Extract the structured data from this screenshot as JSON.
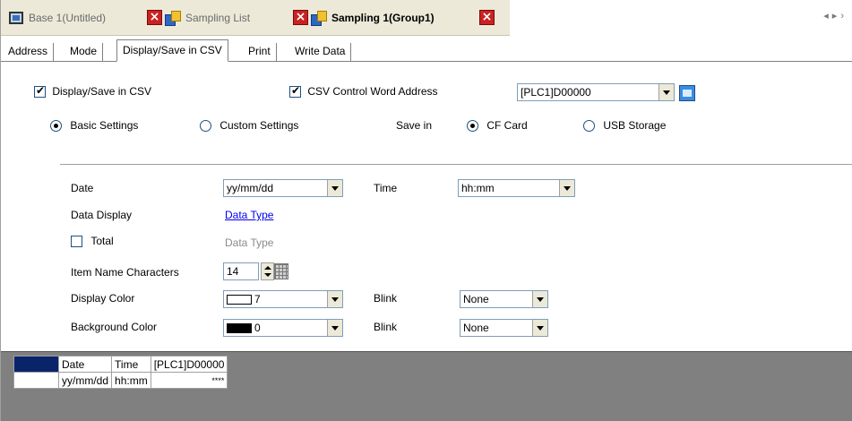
{
  "doc_tabs": [
    {
      "label": "Base 1(Untitled)",
      "icon": "monitor-icon",
      "active": false
    },
    {
      "label": "Sampling List",
      "icon": "list-icon",
      "active": false
    },
    {
      "label": "Sampling 1(Group1)",
      "icon": "list-icon",
      "active": true
    }
  ],
  "prop_tabs": [
    "Address",
    "Mode",
    "Display/Save in CSV",
    "Print",
    "Write Data"
  ],
  "form": {
    "display_save_csv_label": "Display/Save in CSV",
    "csv_control_label": "CSV Control Word Address",
    "csv_address_value": "[PLC1]D00000",
    "basic_settings_label": "Basic Settings",
    "custom_settings_label": "Custom Settings",
    "save_in_label": "Save in",
    "cf_card_label": "CF Card",
    "usb_storage_label": "USB Storage",
    "date_label": "Date",
    "date_value": "yy/mm/dd",
    "time_label": "Time",
    "time_value": "hh:mm",
    "data_display_label": "Data Display",
    "data_type_link": "Data Type",
    "total_label": "Total",
    "total_data_type": "Data Type",
    "item_name_chars_label": "Item Name Characters",
    "item_name_chars_value": "14",
    "display_color_label": "Display Color",
    "display_color_value": "7",
    "blink_label": "Blink",
    "blink1_value": "None",
    "background_color_label": "Background Color",
    "background_color_value": "0",
    "blink2_value": "None"
  },
  "preview": {
    "headers": [
      "Date",
      "Time",
      "[PLC1]D00000"
    ],
    "row": [
      "yy/mm/dd",
      "hh:mm",
      "****"
    ]
  }
}
